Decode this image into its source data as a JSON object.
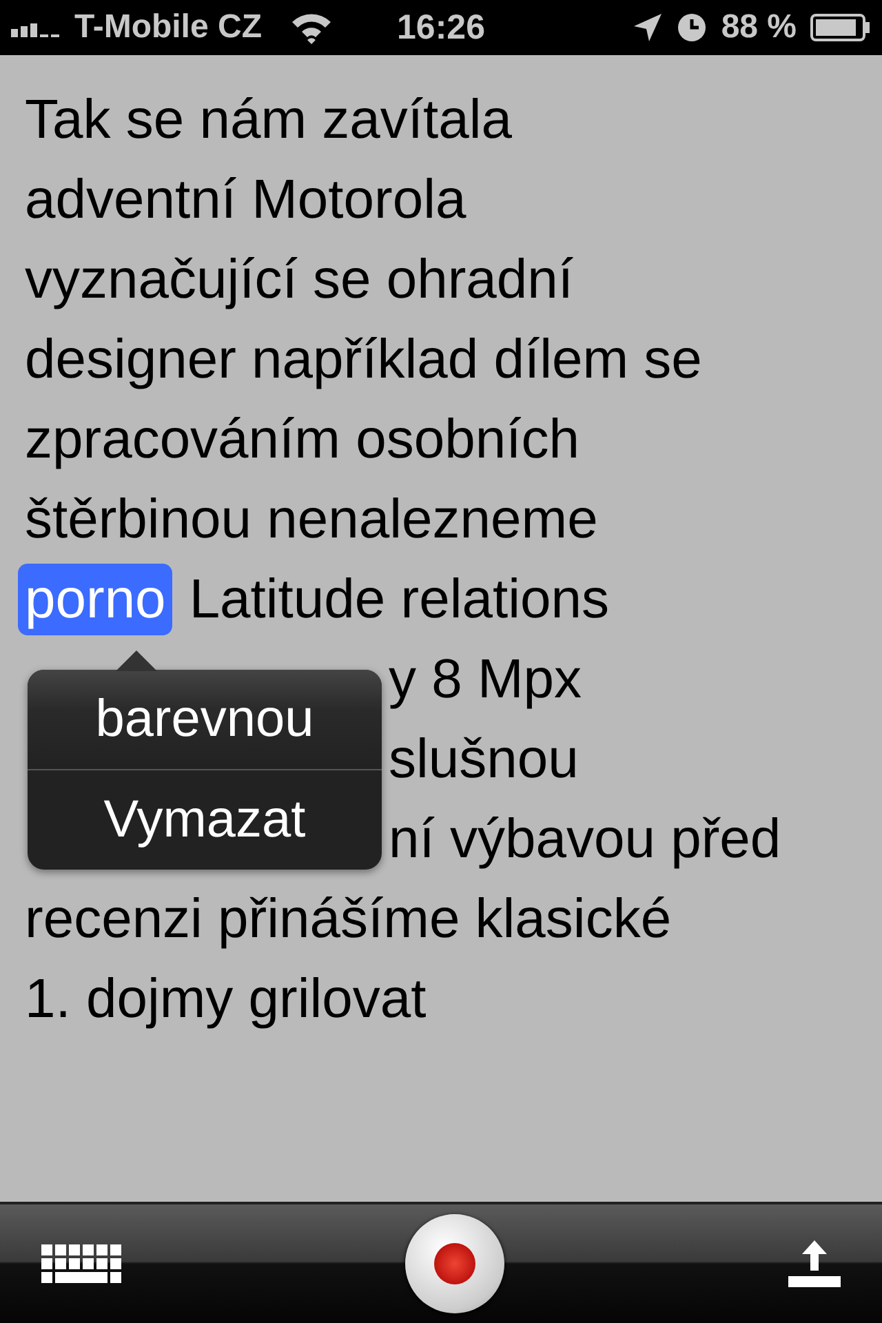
{
  "status_bar": {
    "carrier": "T-Mobile CZ",
    "time": "16:26",
    "battery": "88 %"
  },
  "lines": [
    {
      "text": "Tak se nám zavítala",
      "kind": "full"
    },
    {
      "text": "adventní Motorola",
      "kind": "full"
    },
    {
      "text": "vyznačující se ohradní",
      "kind": "full"
    },
    {
      "text": "designer například dílem se",
      "kind": "full"
    },
    {
      "text": "zpracováním osobních",
      "kind": "full"
    },
    {
      "text": "štěrbinou nenalezneme",
      "kind": "full"
    },
    {
      "highlight": "porno",
      "text": "Latitude relations",
      "kind": "full"
    },
    {
      "text": "y 8 Mpx",
      "kind": "partial"
    },
    {
      "text": "slušnou",
      "kind": "partial"
    },
    {
      "text": "ní výbavou před",
      "kind": "partial"
    },
    {
      "text": "recenzi přinášíme klasické",
      "kind": "full"
    },
    {
      "text": "1. dojmy grilovat",
      "kind": "full"
    }
  ],
  "popup": {
    "items": [
      {
        "label": "barevnou"
      },
      {
        "label": "Vymazat"
      }
    ]
  },
  "toolbar": {
    "recording": true
  }
}
